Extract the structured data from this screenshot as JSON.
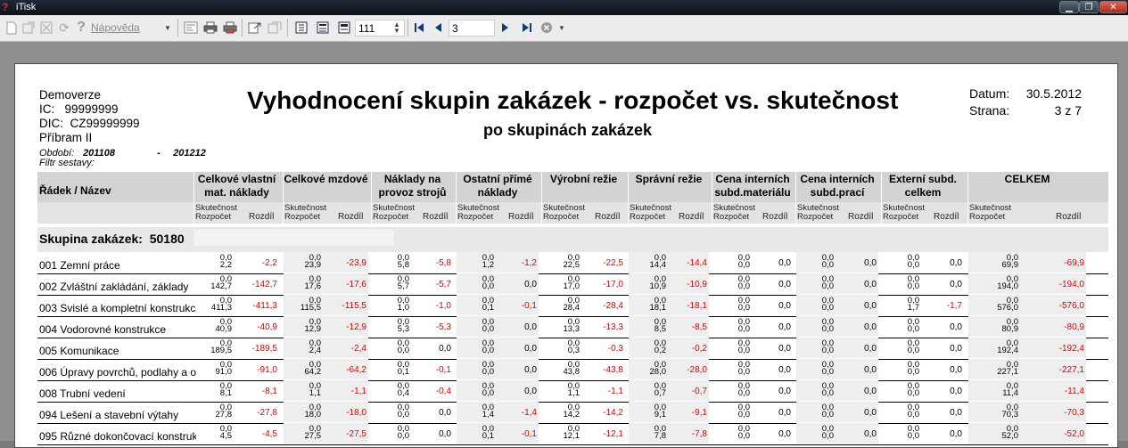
{
  "window": {
    "title": "iTisk",
    "controls": [
      "minimize",
      "restore",
      "close"
    ]
  },
  "toolbar": {
    "help_label": "Nápověda",
    "zoom_value": "111",
    "page_value": "3"
  },
  "report": {
    "company_lines": [
      "Demoverze",
      "IC:   99999999",
      "DIC:  CZ99999999",
      "Příbram II"
    ],
    "period_label": "Období:",
    "period_from": "201108",
    "period_dash": "-",
    "period_to": "201212",
    "filter_label": "Filtr sestavy:",
    "title": "Vyhodnocení skupin zakázek - rozpočet vs. skutečnost",
    "subtitle": "po skupinách zakázek",
    "date_label": "Datum:",
    "date_value": "30.5.2012",
    "page_label": "Strana:",
    "page_value": "3 z 7"
  },
  "table": {
    "row_header": "Řádek / Název",
    "columns": [
      "Celkové vlastní mat. náklady",
      "Celkové mzdové",
      "Náklady na provoz strojů",
      "Ostatní přímé náklady",
      "Výrobní režie",
      "Správní režie",
      "Cena interních subd.materiálu",
      "Cena interních subd.prací",
      "Externí subd. celkem",
      "CELKEM"
    ],
    "sub_actual": "Skutečnost",
    "sub_budget": "Rozpočet",
    "sub_diff": "Rozdíl",
    "group_label": "Skupina zakázek:",
    "group_value": "50180",
    "rows": [
      {
        "name": "001 Zemní práce",
        "cells": [
          [
            "0,0",
            "2,2",
            "-2,2"
          ],
          [
            "0,0",
            "23,9",
            "-23,9"
          ],
          [
            "0,0",
            "5,8",
            "-5,8"
          ],
          [
            "0,0",
            "1,2",
            "-1,2"
          ],
          [
            "0,0",
            "22,5",
            "-22,5"
          ],
          [
            "0,0",
            "14,4",
            "-14,4"
          ],
          [
            "0,0",
            "0,0",
            "0,0"
          ],
          [
            "0,0",
            "0,0",
            "0,0"
          ],
          [
            "0,0",
            "0,0",
            "0,0"
          ],
          [
            "0,0",
            "69,9",
            "-69,9"
          ]
        ]
      },
      {
        "name": "002 Zvláštní zakládání, základy",
        "cells": [
          [
            "0,0",
            "142,7",
            "-142,7"
          ],
          [
            "0,0",
            "17,6",
            "-17,6"
          ],
          [
            "0,0",
            "5,7",
            "-5,7"
          ],
          [
            "0,0",
            "0,0",
            "0,0"
          ],
          [
            "0,0",
            "17,0",
            "-17,0"
          ],
          [
            "0,0",
            "10,9",
            "-10,9"
          ],
          [
            "0,0",
            "0,0",
            "0,0"
          ],
          [
            "0,0",
            "0,0",
            "0,0"
          ],
          [
            "0,0",
            "0,0",
            "0,0"
          ],
          [
            "0,0",
            "194,0",
            "-194,0"
          ]
        ]
      },
      {
        "name": "003 Svislé a kompletní konstrukce",
        "cells": [
          [
            "0,0",
            "411,3",
            "-411,3"
          ],
          [
            "0,0",
            "115,5",
            "-115,5"
          ],
          [
            "0,0",
            "1,0",
            "-1,0"
          ],
          [
            "0,0",
            "0,1",
            "-0,1"
          ],
          [
            "0,0",
            "28,4",
            "-28,4"
          ],
          [
            "0,0",
            "18,1",
            "-18,1"
          ],
          [
            "0,0",
            "0,0",
            "0,0"
          ],
          [
            "0,0",
            "0,0",
            "0,0"
          ],
          [
            "0,0",
            "1,7",
            "-1,7"
          ],
          [
            "0,0",
            "576,0",
            "-576,0"
          ]
        ]
      },
      {
        "name": "004 Vodorovné konstrukce",
        "cells": [
          [
            "0,0",
            "40,9",
            "-40,9"
          ],
          [
            "0,0",
            "12,9",
            "-12,9"
          ],
          [
            "0,0",
            "5,3",
            "-5,3"
          ],
          [
            "0,0",
            "0,0",
            "0,0"
          ],
          [
            "0,0",
            "13,3",
            "-13,3"
          ],
          [
            "0,0",
            "8,5",
            "-8,5"
          ],
          [
            "0,0",
            "0,0",
            "0,0"
          ],
          [
            "0,0",
            "0,0",
            "0,0"
          ],
          [
            "0,0",
            "0,0",
            "0,0"
          ],
          [
            "0,0",
            "80,9",
            "-80,9"
          ]
        ]
      },
      {
        "name": "005 Komunikace",
        "cells": [
          [
            "0,0",
            "189,5",
            "-189,5"
          ],
          [
            "0,0",
            "2,4",
            "-2,4"
          ],
          [
            "0,0",
            "0,0",
            "0,0"
          ],
          [
            "0,0",
            "0,0",
            "0,0"
          ],
          [
            "0,0",
            "0,3",
            "-0,3"
          ],
          [
            "0,0",
            "0,2",
            "-0,2"
          ],
          [
            "0,0",
            "0,0",
            "0,0"
          ],
          [
            "0,0",
            "0,0",
            "0,0"
          ],
          [
            "0,0",
            "0,0",
            "0,0"
          ],
          [
            "0,0",
            "192,4",
            "-192,4"
          ]
        ]
      },
      {
        "name": "006 Úpravy povrchů, podlahy a osazení",
        "cells": [
          [
            "0,0",
            "91,0",
            "-91,0"
          ],
          [
            "0,0",
            "64,2",
            "-64,2"
          ],
          [
            "0,0",
            "0,1",
            "-0,1"
          ],
          [
            "0,0",
            "0,0",
            "0,0"
          ],
          [
            "0,0",
            "43,8",
            "-43,8"
          ],
          [
            "0,0",
            "28,0",
            "-28,0"
          ],
          [
            "0,0",
            "0,0",
            "0,0"
          ],
          [
            "0,0",
            "0,0",
            "0,0"
          ],
          [
            "0,0",
            "0,0",
            "0,0"
          ],
          [
            "0,0",
            "227,1",
            "-227,1"
          ]
        ]
      },
      {
        "name": "008 Trubní vedení",
        "cells": [
          [
            "0,0",
            "8,1",
            "-8,1"
          ],
          [
            "0,0",
            "1,1",
            "-1,1"
          ],
          [
            "0,0",
            "0,4",
            "-0,4"
          ],
          [
            "0,0",
            "0,0",
            "0,0"
          ],
          [
            "0,0",
            "1,1",
            "-1,1"
          ],
          [
            "0,0",
            "0,7",
            "-0,7"
          ],
          [
            "0,0",
            "0,0",
            "0,0"
          ],
          [
            "0,0",
            "0,0",
            "0,0"
          ],
          [
            "0,0",
            "0,0",
            "0,0"
          ],
          [
            "0,0",
            "11,4",
            "-11,4"
          ]
        ]
      },
      {
        "name": "094 Lešení a stavební výtahy",
        "cells": [
          [
            "0,0",
            "27,8",
            "-27,8"
          ],
          [
            "0,0",
            "18,0",
            "-18,0"
          ],
          [
            "0,0",
            "0,0",
            "0,0"
          ],
          [
            "0,0",
            "1,4",
            "-1,4"
          ],
          [
            "0,0",
            "14,2",
            "-14,2"
          ],
          [
            "0,0",
            "9,1",
            "-9,1"
          ],
          [
            "0,0",
            "0,0",
            "0,0"
          ],
          [
            "0,0",
            "0,0",
            "0,0"
          ],
          [
            "0,0",
            "0,0",
            "0,0"
          ],
          [
            "0,0",
            "70,3",
            "-70,3"
          ]
        ]
      },
      {
        "name": "095 Různé dokončovací konstrukce",
        "cells": [
          [
            "0,0",
            "4,5",
            "-4,5"
          ],
          [
            "0,0",
            "27,5",
            "-27,5"
          ],
          [
            "0,0",
            "0,0",
            "0,0"
          ],
          [
            "0,0",
            "0,1",
            "-0,1"
          ],
          [
            "0,0",
            "12,1",
            "-12,1"
          ],
          [
            "0,0",
            "7,8",
            "-7,8"
          ],
          [
            "0,0",
            "0,0",
            "0,0"
          ],
          [
            "0,0",
            "0,0",
            "0,0"
          ],
          [
            "0,0",
            "0,0",
            "0,0"
          ],
          [
            "0,0",
            "52,0",
            "-52,0"
          ]
        ]
      }
    ]
  },
  "colors": {
    "negative": "#e00000",
    "header_bg": "#d3d3d3"
  }
}
